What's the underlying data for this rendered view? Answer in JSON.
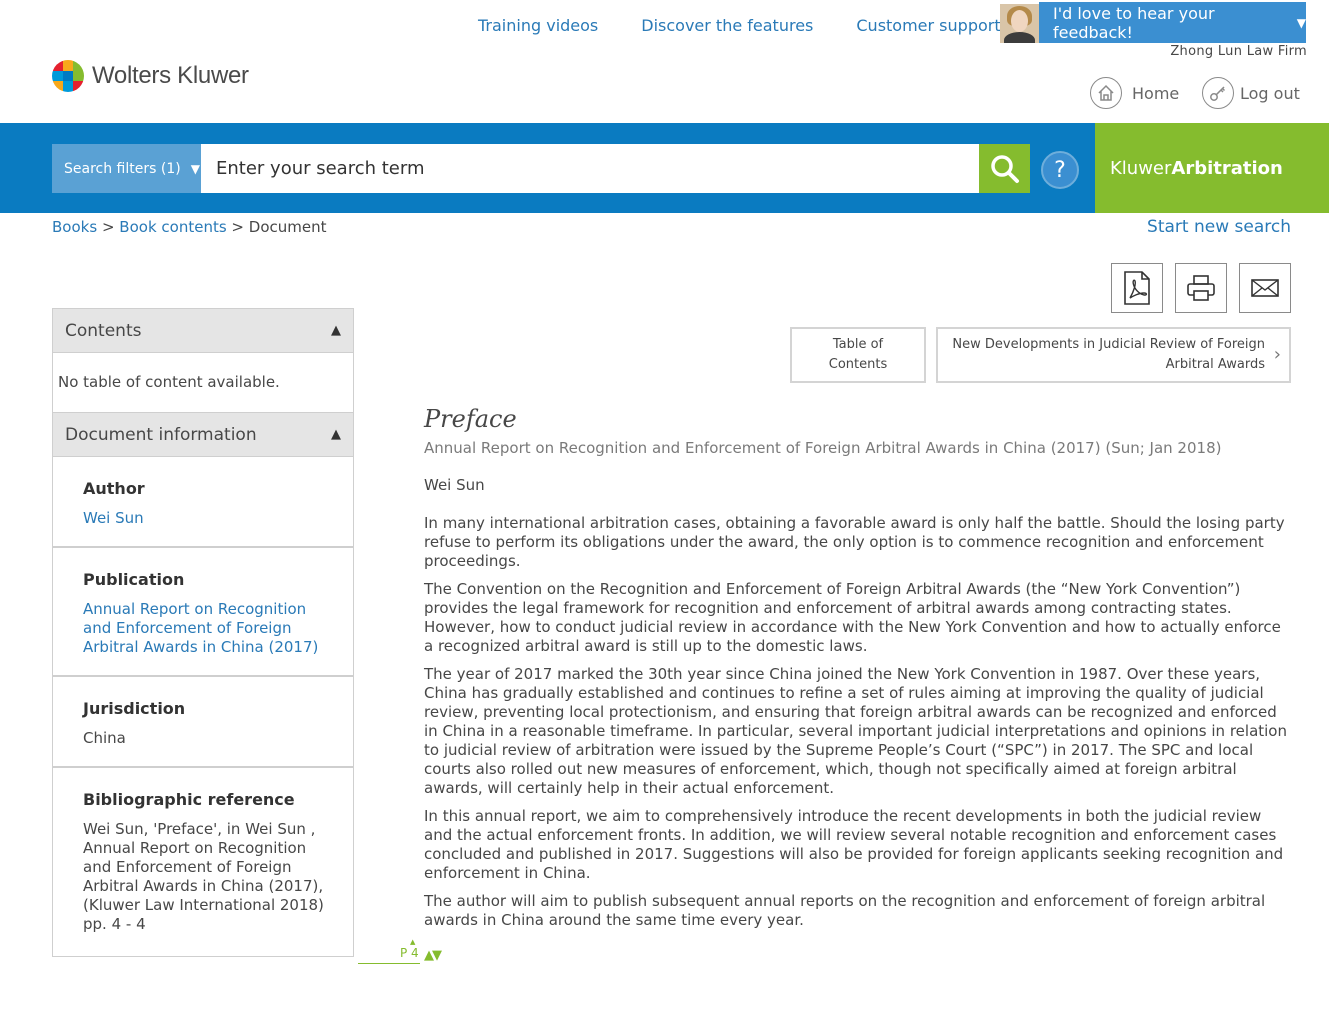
{
  "brand": {
    "logo_text": "Wolters Kluwer",
    "logo_colors": [
      "#e5202e",
      "#f8a81a",
      "#85bc2e",
      "#009ad9",
      "#007ac3",
      "#85bc2e",
      "#f8a81a",
      "#009ad9",
      "#e5202e"
    ],
    "product_prefix": "Kluwer",
    "product_name": "Arbitration"
  },
  "top_links": [
    "Training videos",
    "Discover the features",
    "Customer support"
  ],
  "feedback": {
    "label": "I'd love to hear your feedback!"
  },
  "account": {
    "firm": "Zhong Lun Law Firm",
    "home_label": "Home",
    "logout_label": "Log out"
  },
  "search": {
    "filters_label": "Search filters (1)",
    "placeholder": "Enter your search term",
    "help_label": "?"
  },
  "breadcrumb": {
    "items": [
      "Books",
      "Book contents"
    ],
    "current": "Document",
    "separator": ">"
  },
  "new_search_label": "Start new search",
  "tools": [
    "pdf-icon",
    "print-icon",
    "email-icon"
  ],
  "nav": {
    "toc_label_1": "Table of",
    "toc_label_2": "Contents",
    "next_label_1": "New Developments in Judicial Review of Foreign",
    "next_label_2": "Arbitral Awards"
  },
  "sidebar": {
    "contents_label": "Contents",
    "contents_empty": "No table of content available.",
    "docinfo_label": "Document information",
    "author_title": "Author",
    "author_value": "Wei Sun",
    "publication_title": "Publication",
    "publication_value": "Annual Report on Recognition and Enforcement of Foreign Arbitral Awards in China (2017)",
    "jurisdiction_title": "Jurisdiction",
    "jurisdiction_value": "China",
    "biblio_title": "Bibliographic reference",
    "biblio_value": "Wei Sun, 'Preface', in Wei Sun , Annual Report on Recognition and Enforcement of Foreign Arbitral Awards in China (2017), (Kluwer Law International 2018) pp. 4 - 4"
  },
  "document": {
    "title": "Preface",
    "subtitle": "Annual Report on Recognition and Enforcement of Foreign Arbitral Awards in China (2017) (Sun; Jan 2018)",
    "author": "Wei Sun",
    "paragraphs": [
      "In many international arbitration cases, obtaining a favorable award is only half the battle. Should the losing party refuse to perform its obligations under the award, the only option is to commence recognition and enforcement proceedings.",
      "The Convention on the Recognition and Enforcement of Foreign Arbitral Awards (the “New York Convention”) provides the legal framework for recognition and enforcement of arbitral awards among contracting states. However, how to conduct judicial review in accordance with the New York Convention and how to actually enforce a recognized arbitral award is still up to the domestic laws.",
      "The year of 2017 marked the 30th year since China joined the New York Convention in 1987. Over these years, China has gradually established and continues to refine a set of rules aiming at improving the quality of judicial review, preventing local protectionism, and ensuring that foreign arbitral awards can be recognized and enforced in China in a reasonable timeframe. In particular, several important judicial interpretations and opinions in relation to judicial review of arbitration were issued by the Supreme People’s Court (“SPC”) in 2017. The SPC and local courts also rolled out new measures of enforcement, which, though not specifically aimed at foreign arbitral awards, will certainly help in their actual enforcement.",
      "In this annual report, we aim to comprehensively introduce the recent developments in both the judicial review and the actual enforcement fronts. In addition, we will review several notable recognition and enforcement cases concluded and published in 2017. Suggestions will also be provided for foreign applicants seeking recognition and enforcement in China.",
      "The author will aim to publish subsequent annual reports on the recognition and enforcement of foreign arbitral awards in China around the same time every year."
    ],
    "page_marker": "P 4"
  },
  "colors": {
    "blue_bar": "#0a7bc1",
    "green": "#85bc2e",
    "link": "#2a7ab7"
  }
}
